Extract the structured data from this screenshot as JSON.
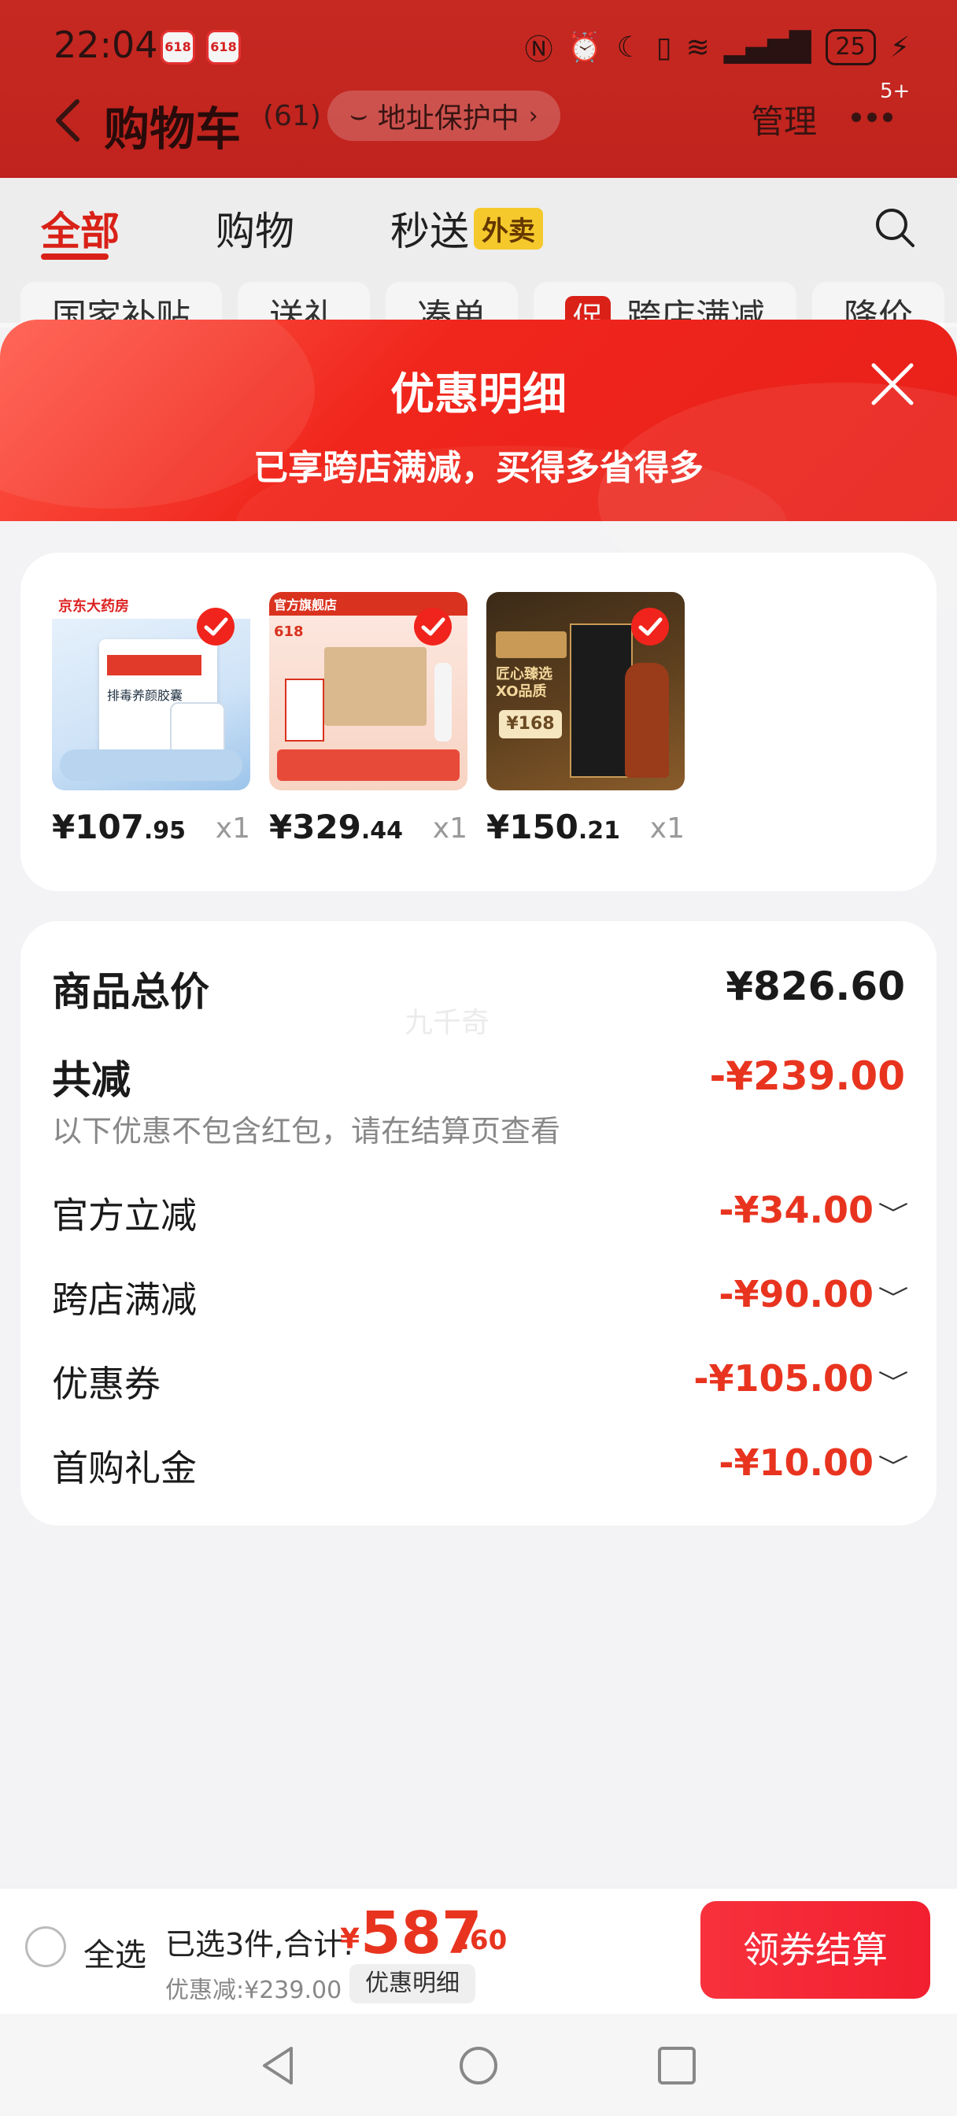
{
  "status": {
    "time": "22:04",
    "app_badge_1": "618",
    "app_badge_2": "618",
    "battery": "25"
  },
  "header": {
    "title": "购物车",
    "count": "(61)",
    "address": "地址保护中",
    "manage": "管理",
    "notif": "5+"
  },
  "tabs": [
    {
      "label": "全部"
    },
    {
      "label": "购物"
    },
    {
      "label": "秒送",
      "tag": "外卖"
    }
  ],
  "chips": [
    {
      "label": "国家补贴"
    },
    {
      "label": "送礼"
    },
    {
      "label": "凑单"
    },
    {
      "label": "跨店满减",
      "tag": "促"
    },
    {
      "label": "降价"
    }
  ],
  "modal": {
    "title": "优惠明细",
    "subtitle": "已享跨店满减，买得多省得多"
  },
  "products": [
    {
      "price_int": "¥107",
      "price_dec": ".95",
      "qty": "x1",
      "brand": "京东大药房",
      "thumb_text": "排毒养颜胶囊",
      "accent": "#2f7de1"
    },
    {
      "price_int": "¥329",
      "price_dec": ".44",
      "qty": "x1",
      "brand": "官方旗舰店",
      "thumb_text": "618",
      "accent": "#e84a3a"
    },
    {
      "price_int": "¥150",
      "price_dec": ".21",
      "qty": "x1",
      "brand": "匠心臻选 XO品质",
      "thumb_text": "¥168",
      "accent": "#6b4a22"
    }
  ],
  "summary": {
    "total_label": "商品总价",
    "total_value": "¥826.60",
    "watermark": "九千奇",
    "reduce_label": "共减",
    "reduce_value": "-¥239.00",
    "note": "以下优惠不包含红包，请在结算页查看",
    "items": [
      {
        "label": "官方立减",
        "value": "-¥34.00"
      },
      {
        "label": "跨店满减",
        "value": "-¥90.00"
      },
      {
        "label": "优惠券",
        "value": "-¥105.00"
      },
      {
        "label": "首购礼金",
        "value": "-¥10.00"
      }
    ]
  },
  "bottom": {
    "select_all": "全选",
    "selected": "已选3件,合计:",
    "currency": "¥",
    "total_int": "587",
    "total_dec": ".60",
    "discount": "优惠减:¥239.00",
    "detail_chip": "优惠明细",
    "checkout": "领券结算"
  },
  "colors": {
    "brand_red": "#e2231a",
    "price_red": "#e8341f"
  }
}
